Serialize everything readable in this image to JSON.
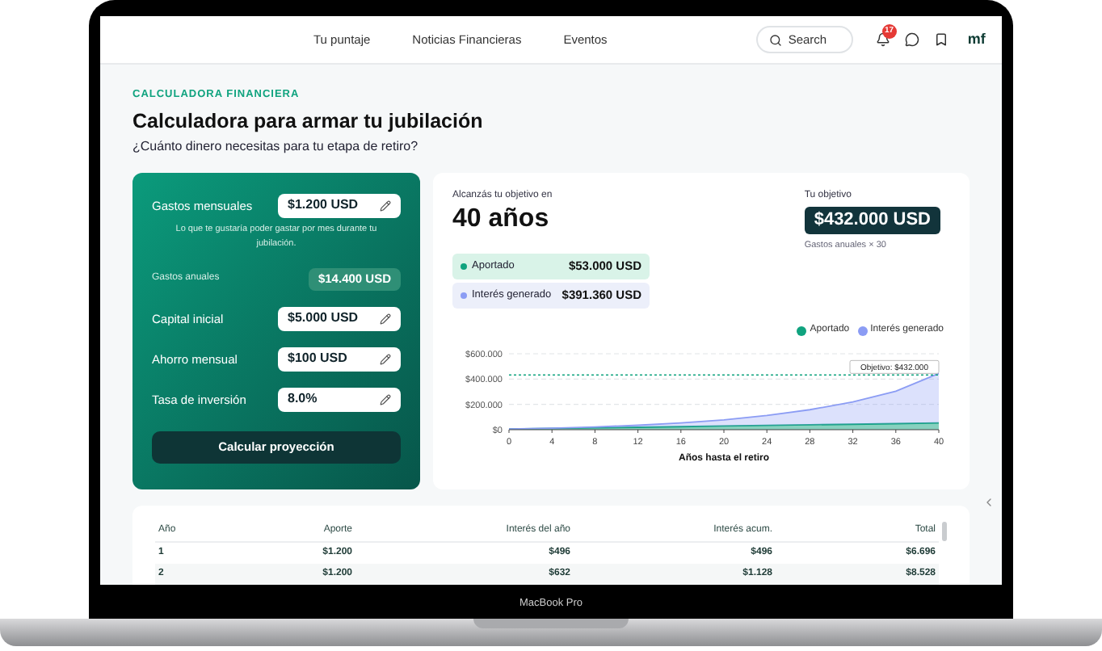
{
  "header": {
    "nav": [
      {
        "label": "Tu puntaje"
      },
      {
        "label": "Noticias Financieras"
      },
      {
        "label": "Eventos"
      }
    ],
    "search": {
      "placeholder": "Search"
    },
    "notifications": {
      "badge": "17"
    },
    "logo": "mf"
  },
  "intro": {
    "eyebrow": "CALCULADORA FINANCIERA",
    "title": "Calculadora para armar tu jubilación",
    "subtitle": "¿Cuánto dinero necesitas para tu etapa de retiro?"
  },
  "calculator": {
    "fields": [
      {
        "kind": "input",
        "label": "Gastos mensuales",
        "value": "$1.200 USD",
        "hint": "Lo que te gustaría poder gastar por mes durante tu jubilación."
      },
      {
        "kind": "computed",
        "label": "Gastos anuales",
        "value": "$14.400 USD"
      },
      {
        "kind": "input",
        "label": "Capital inicial",
        "value": "$5.000 USD"
      },
      {
        "kind": "input",
        "label": "Ahorro mensual",
        "value": "$100 USD"
      },
      {
        "kind": "input",
        "label": "Tasa de inversión",
        "value": "8.0%"
      }
    ],
    "button": "Calcular proyección"
  },
  "result": {
    "reach_label": "Alcanzás tu objetivo en",
    "years": "40 años",
    "goal_label": "Tu objetivo",
    "goal": "$432.000 USD",
    "goal_note": "Gastos anuales × 30",
    "stats": [
      {
        "label": "Aportado",
        "value": "$53.000 USD",
        "color": "#10a37f"
      },
      {
        "label": "Interés generado",
        "value": "$391.360 USD",
        "color": "#8b9cf4"
      }
    ],
    "chart_data": {
      "type": "area",
      "xlabel": "Años hasta el retiro",
      "x": [
        0,
        4,
        8,
        12,
        16,
        20,
        24,
        28,
        32,
        36,
        40
      ],
      "stacked": true,
      "series": [
        {
          "name": "Aportado",
          "color": "#10a37f",
          "values": [
            5,
            10,
            15,
            19,
            24,
            29,
            34,
            39,
            43,
            48,
            53
          ]
        },
        {
          "name": "Interés generado",
          "color": "#8b9cf4",
          "values": [
            0,
            2,
            7,
            16,
            29,
            49,
            78,
            119,
            176,
            256,
            391
          ]
        }
      ],
      "xlim": [
        0,
        40
      ],
      "ylim": [
        0,
        600
      ],
      "xticks": [
        0,
        4,
        8,
        12,
        16,
        20,
        24,
        28,
        32,
        36,
        40
      ],
      "yticks": [
        {
          "value": 0,
          "label": "$0"
        },
        {
          "value": 200,
          "label": "$200.000"
        },
        {
          "value": 400,
          "label": "$400.000"
        },
        {
          "value": 600,
          "label": "$600.000"
        }
      ],
      "ref_lines": [
        {
          "axis": "y",
          "value": 432,
          "label": "Objetivo: $432.000"
        }
      ]
    }
  },
  "table": {
    "columns": [
      "Año",
      "Aporte",
      "Interés del año",
      "Interés acum.",
      "Total"
    ],
    "rows": [
      [
        "1",
        "$1.200",
        "$496",
        "$496",
        "$6.696"
      ],
      [
        "2",
        "$1.200",
        "$632",
        "$1.128",
        "$8.528"
      ]
    ]
  },
  "device_label": "MacBook Pro"
}
